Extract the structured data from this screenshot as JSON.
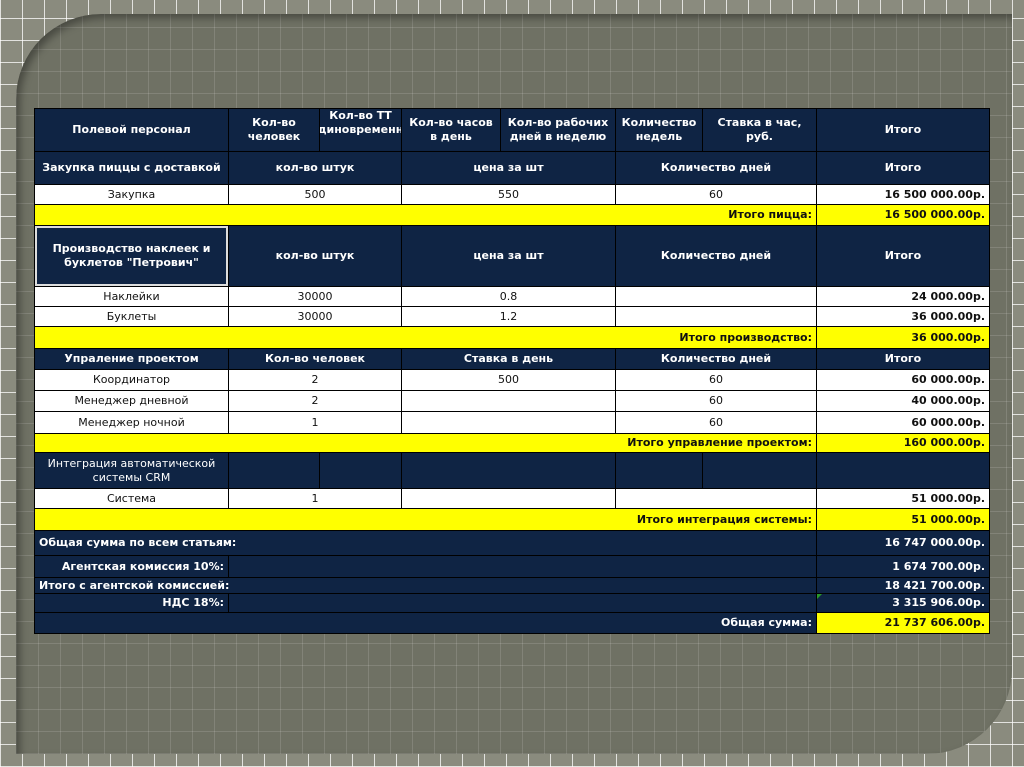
{
  "header": {
    "title": "Полевой персонал",
    "cols": [
      "Кол-во человек",
      "Кол-во ТТ единовременно",
      "Кол-во часов в день",
      "Кол-во рабочих дней в неделю",
      "Количество недель",
      "Ставка в час, руб.",
      "Итого"
    ]
  },
  "pizza": {
    "title": "Закупка пиццы с доставкой",
    "cols": [
      "кол-во штук",
      "цена за шт",
      "Количество дней",
      "Итого"
    ],
    "row": {
      "name": "Закупка",
      "qty": "500",
      "price": "550",
      "days": "60",
      "total": "16 500 000.00р."
    },
    "subtotal_label": "Итого пицца:",
    "subtotal": "16 500 000.00р."
  },
  "production": {
    "title": "Производство наклеек и буклетов \"Петрович\"",
    "cols": [
      "кол-во штук",
      "цена за шт",
      "Количество дней",
      "Итого"
    ],
    "rows": [
      {
        "name": "Наклейки",
        "qty": "30000",
        "price": "0.8",
        "total": "24 000.00р."
      },
      {
        "name": "Буклеты",
        "qty": "30000",
        "price": "1.2",
        "total": "36 000.00р."
      }
    ],
    "subtotal_label": "Итого производство:",
    "subtotal": "36 000.00р."
  },
  "management": {
    "title": "Упраление проектом",
    "cols": [
      "Кол-во человек",
      "Ставка в день",
      "Количество дней",
      "Итого"
    ],
    "rows": [
      {
        "name": "Координатор",
        "people": "2",
        "rate": "500",
        "days": "60",
        "total": "60 000.00р."
      },
      {
        "name": "Менеджер дневной",
        "people": "2",
        "rate": "",
        "days": "60",
        "total": "40 000.00р."
      },
      {
        "name": "Менеджер ночной",
        "people": "1",
        "rate": "",
        "days": "60",
        "total": "60 000.00р."
      }
    ],
    "subtotal_label": "Итого управление проектом:",
    "subtotal": "160 000.00р."
  },
  "crm": {
    "title": "Интеграция автоматической системы CRM",
    "row": {
      "name": "Система",
      "qty": "1",
      "total": "51 000.00р."
    },
    "subtotal_label": "Итого интеграция системы:",
    "subtotal": "51 000.00р."
  },
  "summary": {
    "all_label": "Общая сумма по всем статьям:",
    "all": "16 747 000.00р.",
    "agency_label": "Агентская комиссия 10%:",
    "agency": "1 674 700.00р.",
    "with_agency_label": "Итого с агентской комиссией:",
    "with_agency": "18 421 700.00р.",
    "vat_label": "НДС 18%:",
    "vat": "3 315 906.00р.",
    "grand_label": "Общая сумма:",
    "grand": "21 737 606.00р."
  }
}
